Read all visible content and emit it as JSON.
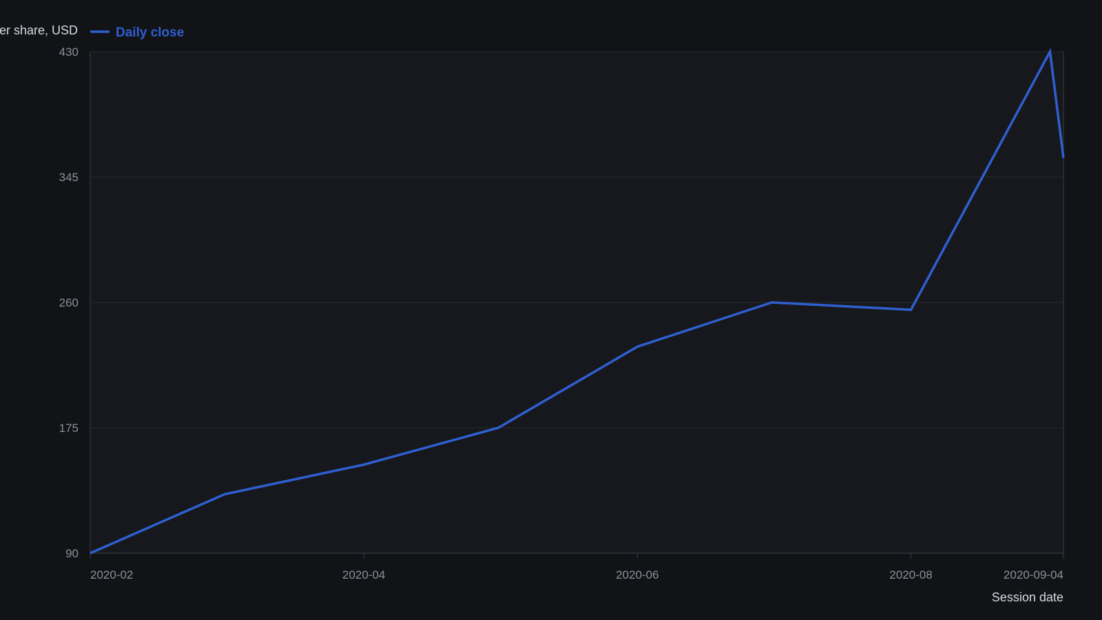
{
  "chart_data": {
    "type": "line",
    "title": "",
    "ylabel": "Price per share, USD",
    "xlabel": "Session date",
    "ylim": [
      90,
      430
    ],
    "yticks": [
      90,
      175,
      260,
      345,
      430
    ],
    "xlim": [
      "2020-01-31",
      "2020-09-04"
    ],
    "xticks": [
      {
        "label": "2020-02",
        "date": "2020-01-31"
      },
      {
        "label": "2020-04",
        "date": "2020-04-01"
      },
      {
        "label": "2020-06",
        "date": "2020-06-01"
      },
      {
        "label": "2020-08",
        "date": "2020-08-01"
      },
      {
        "label": "2020-09-04",
        "date": "2020-09-04"
      }
    ],
    "grid": true,
    "legend_position": "top-left",
    "series": [
      {
        "name": "Daily close",
        "color": "#2f5fd0",
        "points": [
          {
            "x": "2020-01-31",
            "y": 90
          },
          {
            "x": "2020-03-01",
            "y": 130
          },
          {
            "x": "2020-04-01",
            "y": 150
          },
          {
            "x": "2020-05-01",
            "y": 175
          },
          {
            "x": "2020-06-01",
            "y": 230
          },
          {
            "x": "2020-07-01",
            "y": 260
          },
          {
            "x": "2020-08-01",
            "y": 255
          },
          {
            "x": "2020-09-01",
            "y": 430
          },
          {
            "x": "2020-09-04",
            "y": 358
          }
        ]
      }
    ]
  },
  "colors": {
    "background": "#111317",
    "plot_background": "#16181d",
    "gridline": "#262a31",
    "axis_line": "#3a3e46"
  }
}
